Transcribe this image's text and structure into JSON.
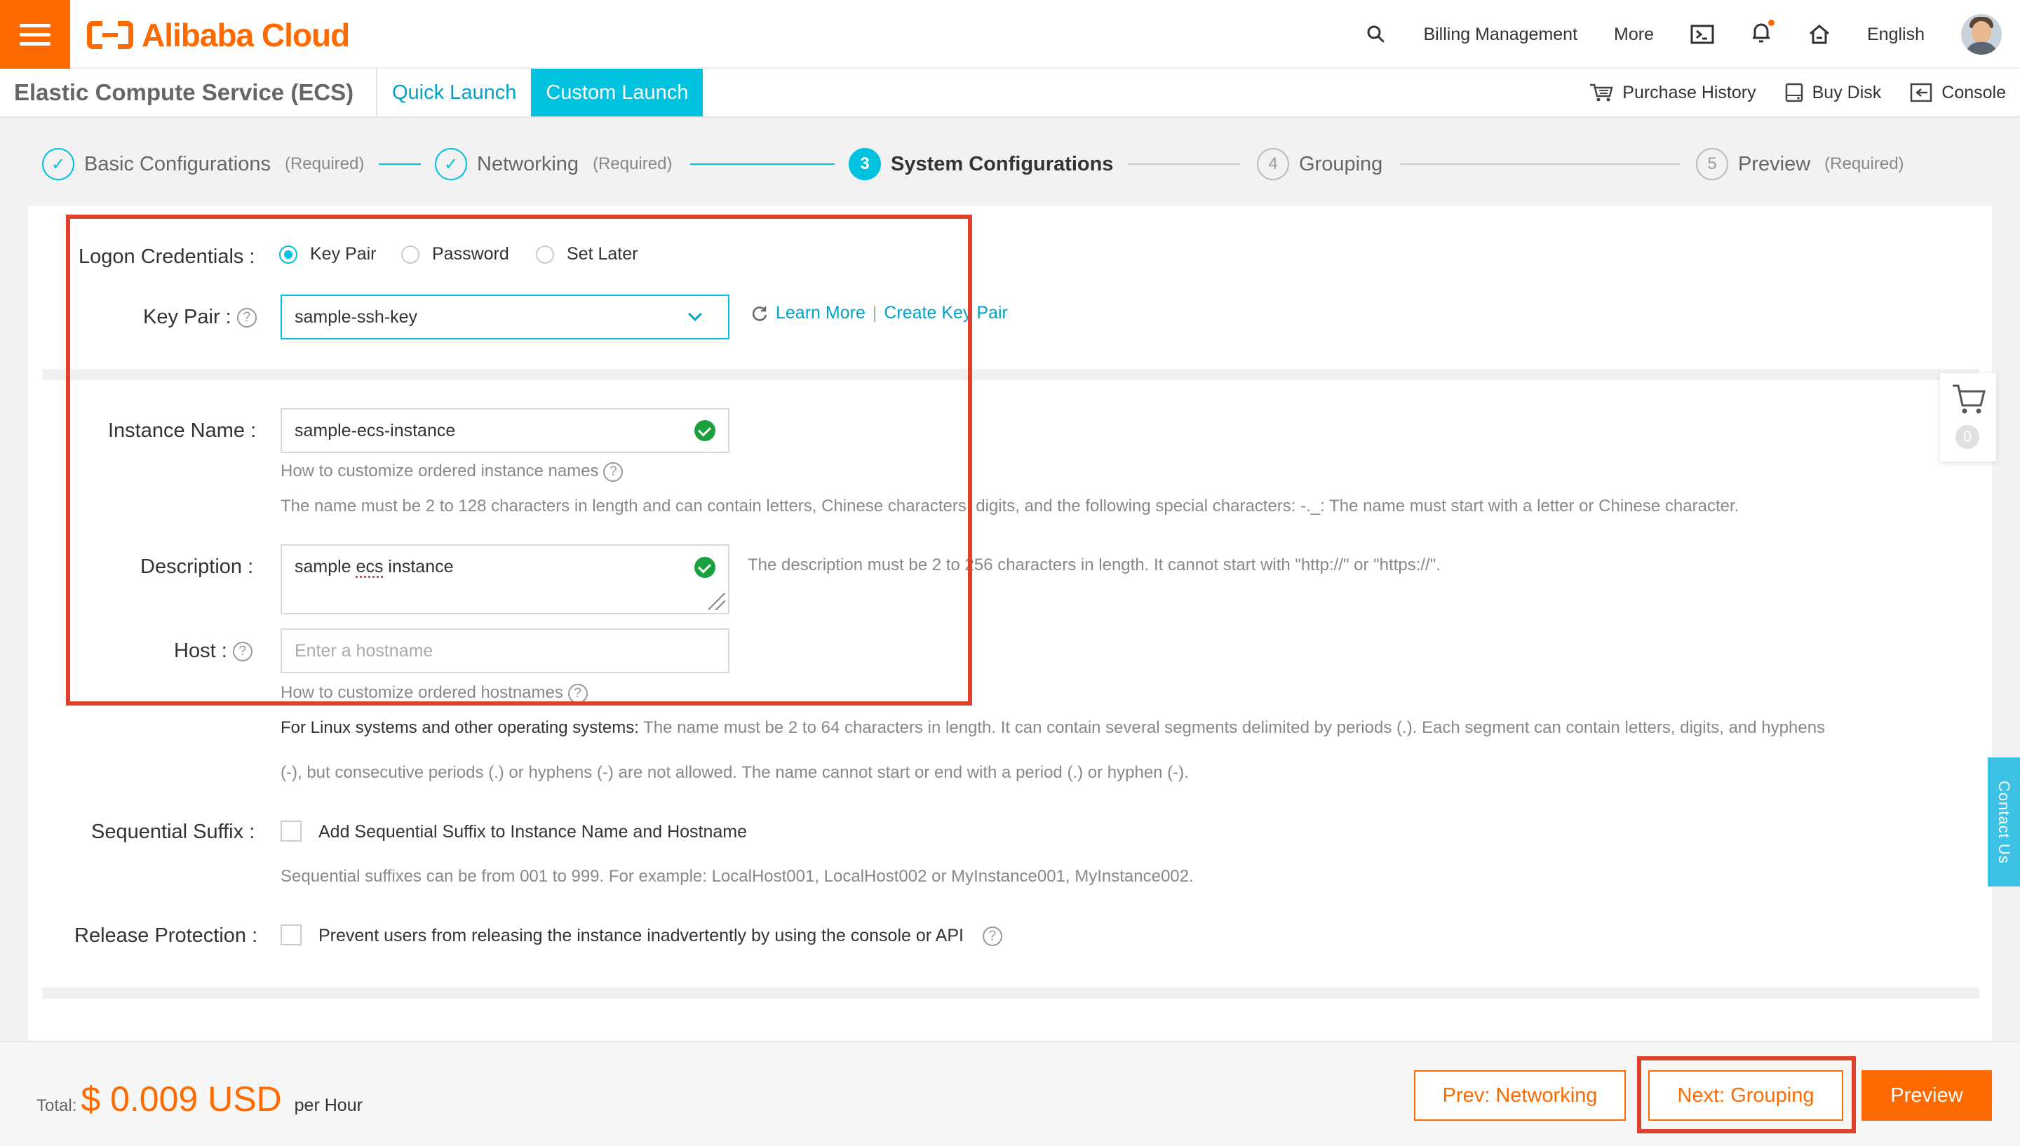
{
  "header": {
    "brand": "Alibaba Cloud",
    "nav": [
      "Billing Management",
      "More"
    ],
    "language": "English",
    "icons": [
      "search-icon",
      "terminal-icon",
      "bell-icon",
      "home-icon"
    ]
  },
  "subheader": {
    "product": "Elastic Compute Service (ECS)",
    "tabs": [
      "Quick Launch",
      "Custom Launch"
    ],
    "active_tab": "Custom Launch",
    "actions": [
      "Purchase History",
      "Buy Disk",
      "Console"
    ]
  },
  "stepper": {
    "steps": [
      {
        "label": "Basic Configurations",
        "note": "(Required)",
        "state": "done"
      },
      {
        "label": "Networking",
        "note": "(Required)",
        "state": "done"
      },
      {
        "label": "System Configurations",
        "number": "3",
        "state": "current"
      },
      {
        "label": "Grouping",
        "number": "4",
        "state": "todo"
      },
      {
        "label": "Preview",
        "number": "5",
        "note": "(Required)",
        "state": "todo"
      }
    ]
  },
  "form": {
    "logon": {
      "label": "Logon Credentials",
      "options": [
        "Key Pair",
        "Password",
        "Set Later"
      ],
      "selected": "Key Pair"
    },
    "keypair": {
      "label": "Key Pair",
      "value": "sample-ssh-key",
      "learn_more": "Learn More",
      "separator": "|",
      "create": "Create Key Pair"
    },
    "instance_name": {
      "label": "Instance Name",
      "value": "sample-ecs-instance",
      "help_link": "How to customize ordered instance names",
      "rule": "The name must be 2 to 128 characters in length and can contain letters, Chinese characters, digits, and the following special characters: -._: The name must start with a letter or Chinese character."
    },
    "description": {
      "label": "Description",
      "value_pre": "sample ",
      "value_misspelled": "ecs",
      "value_post": " instance",
      "rule": "The description must be 2 to 256 characters in length. It cannot start with \"http://\" or \"https://\"."
    },
    "host": {
      "label": "Host",
      "placeholder": "Enter a hostname",
      "help_link": "How to customize ordered hostnames",
      "rule_bold": "For Linux systems and other operating systems:",
      "rule_line1": "The name must be 2 to 64 characters in length. It can contain several segments delimited by periods (.). Each segment can contain letters, digits, and hyphens",
      "rule_line2": "(-), but consecutive periods (.) or hyphens (-) are not allowed. The name cannot start or end with a period (.) or hyphen (-)."
    },
    "sequential_suffix": {
      "label": "Sequential Suffix",
      "checkbox_label": "Add Sequential Suffix to Instance Name and Hostname",
      "checked": false,
      "hint": "Sequential suffixes can be from 001 to 999. For example: LocalHost001, LocalHost002 or MyInstance001, MyInstance002."
    },
    "release_protection": {
      "label": "Release Protection",
      "checkbox_label": "Prevent users from releasing the instance inadvertently by using the console or API",
      "checked": false
    },
    "label_colon": ":"
  },
  "cart": {
    "count": "0"
  },
  "contact": "Contact Us",
  "footer": {
    "total_label": "Total:",
    "price": "$ 0.009 USD",
    "per": "per Hour",
    "buttons": {
      "prev": "Prev: Networking",
      "next": "Next: Grouping",
      "preview": "Preview"
    }
  },
  "colors": {
    "brand_orange": "#ff6a00",
    "accent_cyan": "#00c1de",
    "success_green": "#1aa03e",
    "annotation_red": "#e0412c"
  }
}
